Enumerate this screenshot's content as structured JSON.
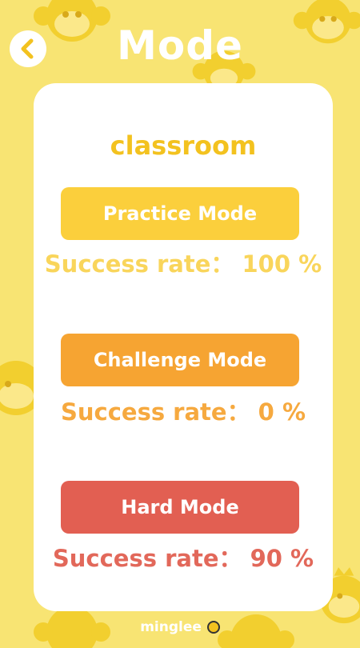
{
  "header": {
    "title": "Mode",
    "back_icon": "chevron-left-icon"
  },
  "card": {
    "subtitle": "classroom"
  },
  "modes": [
    {
      "label": "Practice Mode",
      "rate_text": "Success rate：  100 %",
      "color": "#fbcf3c",
      "rate_color": "#f9d55b"
    },
    {
      "label": "Challenge Mode",
      "rate_text": "Success rate：  0 %",
      "color": "#f6a432",
      "rate_color": "#f6a93f"
    },
    {
      "label": "Hard Mode",
      "rate_text": "Success rate：  90 %",
      "color": "#e25f52",
      "rate_color": "#e2685a"
    }
  ],
  "footer": {
    "logo": "minglee"
  },
  "theme": {
    "background": "#f8e473",
    "accent": "#f3c21f",
    "card": "#ffffff"
  }
}
